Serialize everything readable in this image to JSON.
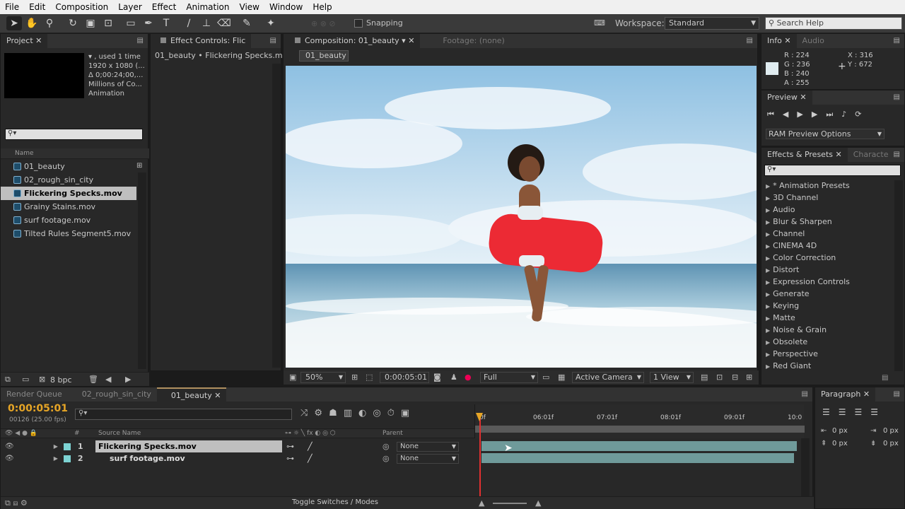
{
  "menu": [
    "File",
    "Edit",
    "Composition",
    "Layer",
    "Effect",
    "Animation",
    "View",
    "Window",
    "Help"
  ],
  "toolbar": {
    "snapping_label": "Snapping",
    "workspace_label": "Workspace:",
    "workspace_value": "Standard",
    "search_placeholder": "Search Help"
  },
  "project": {
    "tab": "Project",
    "info_lines": [
      "▾ , used 1 time",
      "1920 x 1080 (...",
      "Δ 0;00:24;00,...",
      "Millions of Co...",
      "Animation"
    ],
    "name_header": "Name",
    "items": [
      "01_beauty",
      "02_rough_sin_city",
      "Flickering Specks.mov",
      "Grainy Stains.mov",
      "surf footage.mov",
      "Tilted Rules Segment5.mov"
    ],
    "selected_index": 2,
    "bpc": "8 bpc"
  },
  "effect_controls": {
    "tab": "Effect Controls: Flic",
    "subtitle": "01_beauty • Flickering Specks.mov"
  },
  "composition": {
    "tab": "Composition: 01_beauty",
    "footage_tab": "Footage: (none)",
    "sub_tab": "01_beauty",
    "zoom": "50%",
    "timecode": "0:00:05:01",
    "resolution": "Full",
    "camera": "Active Camera",
    "view": "1 View"
  },
  "info": {
    "tab": "Info",
    "audio_tab": "Audio",
    "r": "R : 224",
    "g": "G : 236",
    "b": "B : 240",
    "a": "A : 255",
    "x": "X : 316",
    "y": "Y : 672"
  },
  "preview": {
    "tab": "Preview",
    "ram_options": "RAM Preview Options"
  },
  "effects": {
    "tab": "Effects & Presets",
    "char_tab": "Characte",
    "items": [
      "* Animation Presets",
      "3D Channel",
      "Audio",
      "Blur & Sharpen",
      "Channel",
      "CINEMA 4D",
      "Color Correction",
      "Distort",
      "Expression Controls",
      "Generate",
      "Keying",
      "Matte",
      "Noise & Grain",
      "Obsolete",
      "Perspective",
      "Red Giant"
    ]
  },
  "timeline": {
    "tabs": [
      "Render Queue",
      "02_rough_sin_city",
      "01_beauty"
    ],
    "timecode": "0:00:05:01",
    "frames": "00126 (25.00 fps)",
    "col_source": "Source Name",
    "col_parent": "Parent",
    "col_num": "#",
    "ruler": [
      "0f",
      "06:01f",
      "07:01f",
      "08:01f",
      "09:01f",
      "10:0"
    ],
    "layers": [
      {
        "num": "1",
        "name": "Flickering Specks.mov",
        "parent": "None"
      },
      {
        "num": "2",
        "name": "surf footage.mov",
        "parent": "None"
      }
    ],
    "toggle": "Toggle Switches / Modes"
  },
  "paragraph": {
    "tab": "Paragraph",
    "px1": "0 px",
    "px2": "0 px",
    "px3": "0 px",
    "px4": "0 px"
  },
  "colors": {
    "accent": "#f5a623",
    "bar": "#6f9a9a",
    "selection": "#bfbfbf"
  }
}
